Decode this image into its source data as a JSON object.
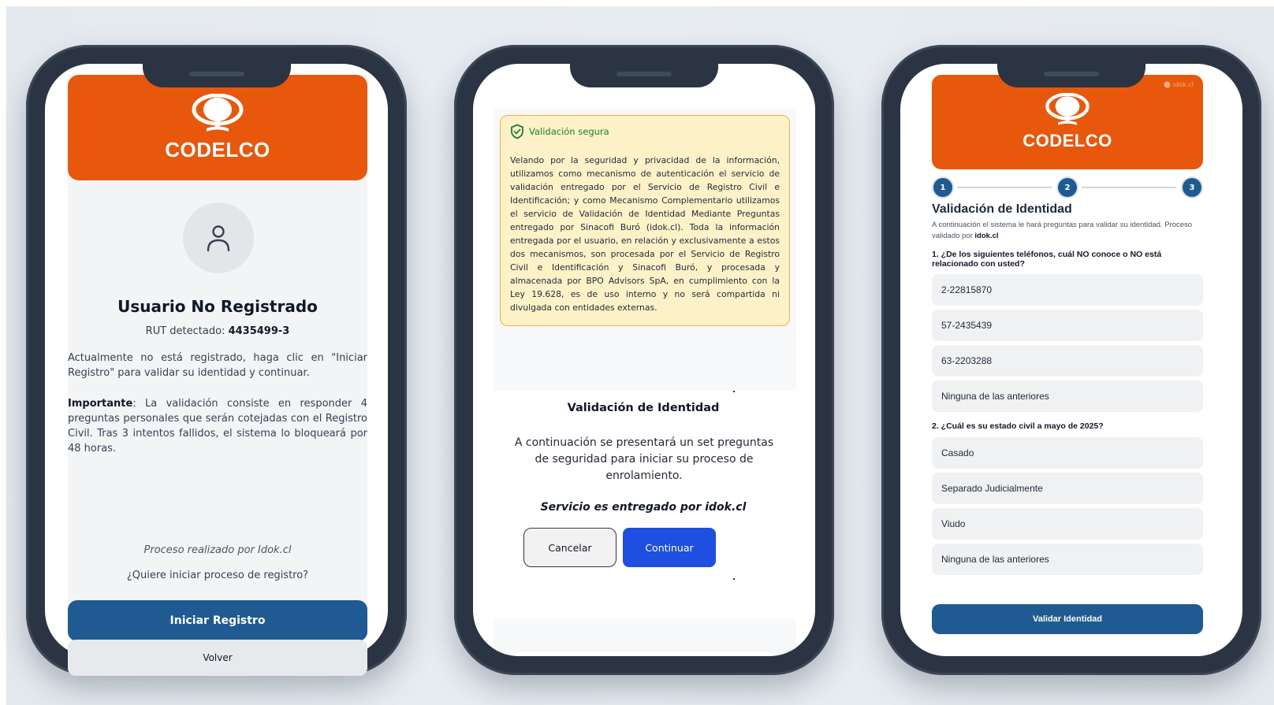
{
  "brand": {
    "name": "CODELCO",
    "color": "#e8580c"
  },
  "phone1": {
    "title": "Usuario No Registrado",
    "rut_label": "RUT detectado:",
    "rut_value": "4435499-3",
    "para1": "Actualmente no está registrado, haga clic en \"Iniciar Registro\" para validar su identidad y continuar.",
    "para2_bold": "Importante",
    "para2_rest": ": La validación consiste en responder 4 preguntas personales que serán cotejadas con el Registro Civil. Tras 3 intentos fallidos, el sistema lo bloqueará por 48 horas.",
    "process": "Proceso realizado por Idok.cl",
    "question": "¿Quiere iniciar proceso de registro?",
    "primary_button": "Iniciar Registro",
    "secondary_button": "Volver",
    "avatar_icon": "user-icon"
  },
  "phone2": {
    "notice_title": "Validación segura",
    "notice_icon": "shield-check-icon",
    "notice_text": "Velando por la seguridad y privacidad de la información, utilizamos como mecanismo de autenticación el servicio de validación entregado por el Servicio de Registro Civil e Identificación; y como Mecanismo Complementario utilizamos el servicio de Validación de Identidad Mediante Preguntas entregado por Sinacofi Buró (idok.cl). Toda la información entregada por el usuario, en relación y exclusivamente a estos dos mecanismos, son procesada por el Servicio de Registro Civil e Identificación y Sinacofi Buró, y procesada y almacenada por BPO Advisors SpA, en cumplimiento con la Ley 19.628, es de uso interno y no será compartida ni divulgada con entidades externas.",
    "dialog_title": "Validación de Identidad",
    "dialog_text": "A continuación se presentará un set preguntas de seguridad para iniciar su proceso de enrolamiento.",
    "dialog_service": "Servicio es entregado por idok.cl",
    "cancel_button": "Cancelar",
    "continue_button": "Continuar"
  },
  "phone3": {
    "idok_tag": "idok.cl",
    "steps": [
      "1",
      "2",
      "3"
    ],
    "title": "Validación de Identidad",
    "desc": "A continuación el sistema le hará preguntas para validar su identidad. Proceso validado por",
    "desc_bold": "idok.cl",
    "q1": "1. ¿De los siguientes teléfonos, cuál NO conoce o NO está relacionado con usted?",
    "q1_options": [
      "2-22815870",
      "57-2435439",
      "63-2203288",
      "Ninguna de las anteriores"
    ],
    "q2": "2. ¿Cuál es su estado civil a mayo de 2025?",
    "q2_options": [
      "Casado",
      "Separado Judicialmente",
      "Viudo",
      "Ninguna de las anteriores"
    ],
    "validate_button": "Validar Identidad"
  }
}
